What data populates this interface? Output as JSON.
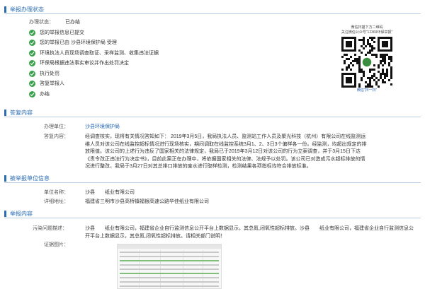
{
  "status_section": {
    "title": "举报办理状态",
    "state_label": "办理状态：",
    "state_value": "已办结",
    "steps": [
      "您的举报信息已提交",
      "您的举报已由 沙县环境保护局 受理",
      "环境执法人员现场调查取证、采样监测、收集违法证据",
      "环保局根据违法事实审议并作出处罚决定",
      "执行处罚",
      "答复举报人",
      "办结"
    ]
  },
  "qr": {
    "caption_1": "微信扫描下方二维码",
    "caption_2": "关注微信公众号“12369环保举报”",
    "caption_3": "微信“扫一扫”",
    "colors": {
      "qr": "#111111",
      "center": "#3a8c3f"
    }
  },
  "reply_section": {
    "title": "答复内容",
    "unit_label": "办理单位：",
    "unit_value": "沙县环境保护局",
    "content_label": "答复内容：",
    "content_value": "经调查核实，现将有关情况答知如下： 2019年3月5日，我局执法人员、监测站工作人员及聚光科技（杭州）有限公司在线监测运维人员对该公司在线监控超标情况进行现场核实，期间调取在线监控系统3月1、2、3日3个偏样各一份。经监测，均超出规定的排放限值。该公司的上述行为违反了国家相关的法律规定，我局已于2019年3月12日对该公司的行为立案调查，并于3月15日下达《责令改正违法行为决定书》，目前此案正在办理中，将依据国家相关的法律、法规予以处罚。该公司已对造成污水超标排放的情况进行整改，我局于3月27日对其总排口排放的废水进行取样检测，检测结果各项指标均符合排放标准。"
  },
  "unit_section": {
    "title": "被举报单位信息",
    "name_label": "单位名称：",
    "name_value": "沙县　　纸业有限公司",
    "addr_label": "详细地址：",
    "addr_value": "福建省三明市沙县高桥镇福银高速公路华佳纸业有限公司"
  },
  "report_section": {
    "title": "举报内容",
    "desc_label": "污染问题描述：",
    "desc_value": "沙县　　纸业有限公司，福建省企业自行监测信息公开平台上数据显示，其总氮,闭氧性超标排放。沙县　　纸业有限公司，福建省企业自行监测信息公开平台上数据显示，其总氮,闭氧性超标排放。请相关部门说明！",
    "evidence_label": "证据图片："
  },
  "colors": {
    "accent": "#2a6db5",
    "check": "#38a14a",
    "link": "#1f5fb0"
  }
}
